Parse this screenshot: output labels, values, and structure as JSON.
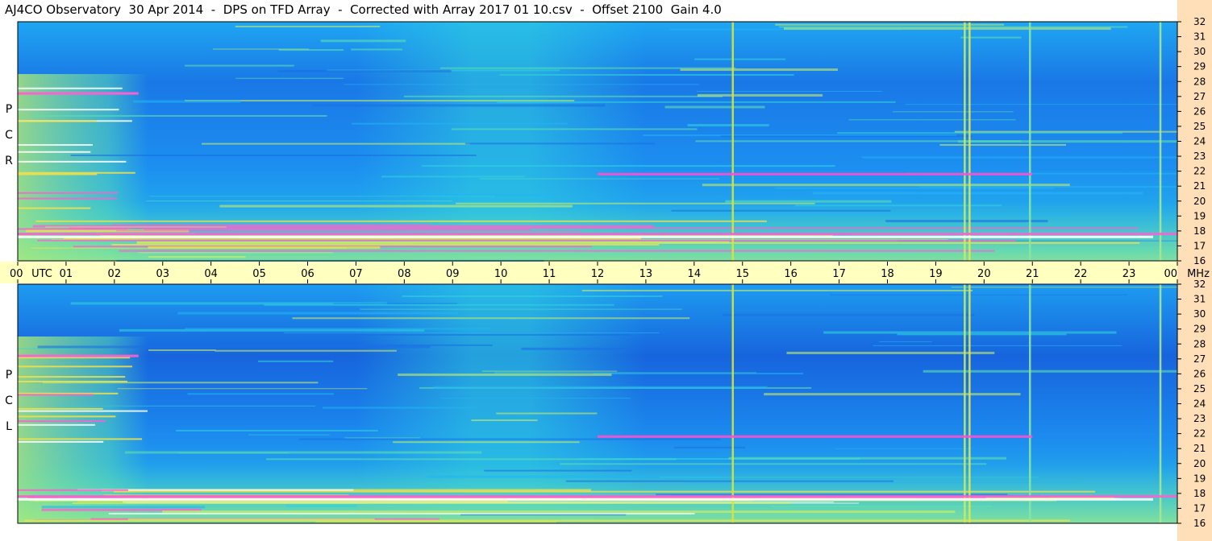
{
  "header": {
    "title": "AJ4CO Observatory  30 Apr 2014  -  DPS on TFD Array  -  Corrected with Array 2017 01 10.csv  -  Offset 2100  Gain 4.0"
  },
  "panels": [
    {
      "id": "rcp",
      "label_letters": [
        "R",
        "C",
        "P"
      ]
    },
    {
      "id": "lcp",
      "label_letters": [
        "L",
        "C",
        "P"
      ]
    }
  ],
  "chart_data": {
    "type": "heatmap",
    "title": "AJ4CO Observatory  30 Apr 2014  -  DPS on TFD Array  -  Corrected with Array 2017 01 10.csv  -  Offset 2100  Gain 4.0",
    "x_axis": {
      "tick_labels": [
        "00",
        "01",
        "02",
        "03",
        "04",
        "05",
        "06",
        "07",
        "08",
        "09",
        "10",
        "11",
        "12",
        "13",
        "14",
        "15",
        "16",
        "17",
        "18",
        "19",
        "20",
        "21",
        "22",
        "23",
        "00"
      ],
      "unit_label": "UTC",
      "range_hours": [
        0,
        24
      ]
    },
    "y_axis": {
      "tick_labels": [
        "32",
        "31",
        "30",
        "29",
        "28",
        "27",
        "26",
        "25",
        "24",
        "23",
        "22",
        "21",
        "20",
        "19",
        "18",
        "17",
        "16"
      ],
      "unit_label": "MHz",
      "range_mhz": [
        16,
        32
      ]
    },
    "panels": [
      "RCP",
      "LCP"
    ],
    "colormap": [
      "#1560e0",
      "#1e8ef0",
      "#22b4f5",
      "#2fd2dd",
      "#5ee0b0",
      "#c6ec6a",
      "#f5e04a",
      "#ff5fd0",
      "#ffffff"
    ],
    "features": [
      {
        "kind": "vertical_line",
        "hour": 14.8,
        "color": "#d6e63a"
      },
      {
        "kind": "vertical_line",
        "hour": 19.6,
        "color": "#c6ec6a"
      },
      {
        "kind": "vertical_line",
        "hour": 19.7,
        "color": "#e2e84a"
      },
      {
        "kind": "vertical_line",
        "hour": 20.95,
        "color": "#8ae6a0"
      },
      {
        "kind": "vertical_line",
        "hour": 23.65,
        "color": "#a8e890"
      },
      {
        "kind": "horizontal_band",
        "mhz": 21.8,
        "hours": [
          12,
          21
        ],
        "color": "#ff4fd0"
      },
      {
        "kind": "horizontal_band",
        "mhz": 17.8,
        "hours": [
          0,
          24
        ],
        "color": "#ff5fd0"
      },
      {
        "kind": "horizontal_band",
        "mhz": 17.6,
        "hours": [
          0,
          23.5
        ],
        "color": "#ffffff"
      },
      {
        "kind": "horizontal_band",
        "mhz": 27.2,
        "hours": [
          0,
          2.5
        ],
        "color": "#ff5fd0"
      }
    ]
  }
}
